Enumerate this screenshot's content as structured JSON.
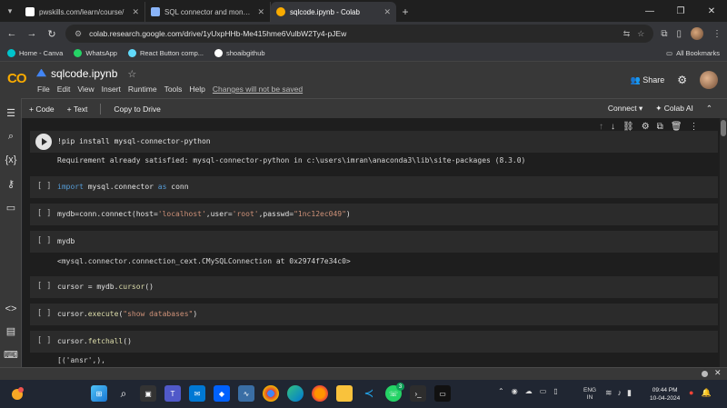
{
  "browser": {
    "tabs": [
      {
        "label": "pwskills.com/learn/course/",
        "active": false,
        "color": "#ffffff"
      },
      {
        "label": "SQL connector and mongo db",
        "active": false,
        "color": "#8ab4f8"
      },
      {
        "label": "sqlcode.ipynb - Colab",
        "active": true,
        "color": "#f9ab00"
      }
    ],
    "new_tab": "+",
    "url": "colab.research.google.com/drive/1yUxpHHb-Me415hme6VulbW2Ty4-pJEw"
  },
  "bookmarks": {
    "items": [
      {
        "label": "Home - Canva",
        "color": "#00c4cc"
      },
      {
        "label": "WhatsApp",
        "color": "#25d366"
      },
      {
        "label": "React Button comp...",
        "color": "#61dafb"
      },
      {
        "label": "shoaibgithub",
        "color": "#ffffff"
      }
    ],
    "all": "All Bookmarks"
  },
  "colab": {
    "logo": "CO",
    "title": "sqlcode.ipynb",
    "menu": [
      "File",
      "Edit",
      "View",
      "Insert",
      "Runtime",
      "Tools",
      "Help"
    ],
    "changes_note": "Changes will not be saved",
    "share": "Share",
    "toolbar": {
      "code": "+ Code",
      "text": "+ Text",
      "copy_drive": "Copy to Drive",
      "connect": "Connect",
      "colab_ai": "Colab AI"
    }
  },
  "cells": [
    {
      "gutter": "",
      "code": "!pip install mysql-connector-python",
      "output": "Requirement already satisfied: mysql-connector-python in c:\\users\\imran\\anaconda3\\lib\\site-packages (8.3.0)"
    },
    {
      "gutter": "[ ]",
      "code": "import mysql.connector as conn",
      "output": ""
    },
    {
      "gutter": "[ ]",
      "code": "mydb=conn.connect(host='localhost',user='root',passwd=\"1nc12ec049\")",
      "output": ""
    },
    {
      "gutter": "[ ]",
      "code": "mydb",
      "output": "<mysql.connector.connection_cext.CMySQLConnection at 0x2974f7e34c0>"
    },
    {
      "gutter": "[ ]",
      "code": "cursor = mydb.cursor()",
      "output": ""
    },
    {
      "gutter": "[ ]",
      "code": "cursor.execute(\"show databases\")",
      "output": ""
    },
    {
      "gutter": "[ ]",
      "code": "cursor.fetchall()",
      "output": "[('ansr',),"
    }
  ],
  "taskbar": {
    "lang_top": "ENG",
    "lang_bottom": "IN",
    "time": "09:44 PM",
    "date": "10-04-2024"
  }
}
